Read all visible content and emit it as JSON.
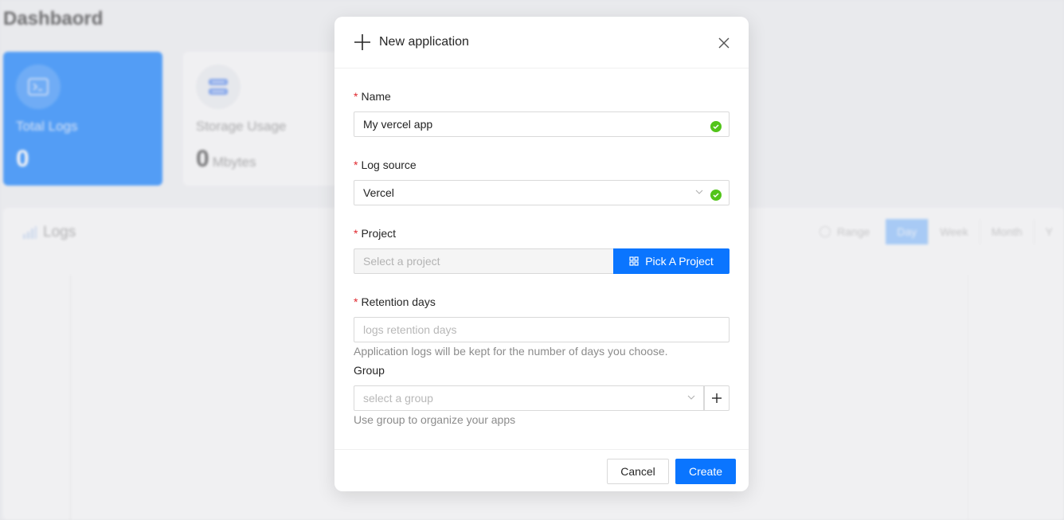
{
  "background": {
    "title": "Dashbaord",
    "cards": [
      {
        "label": "Total Logs",
        "value": "0",
        "unit": "",
        "icon": "terminal-icon"
      },
      {
        "label": "Storage Usage",
        "value": "0",
        "unit": "Mbytes",
        "icon": "storage-icon"
      }
    ],
    "logs": {
      "title": "Logs",
      "range_label": "Range",
      "segments": [
        "Day",
        "Week",
        "Month",
        "Y"
      ],
      "active_segment": "Day"
    }
  },
  "modal": {
    "title": "New application",
    "fields": {
      "name": {
        "label": "Name",
        "value": "My vercel app",
        "required": true,
        "valid": true
      },
      "log_source": {
        "label": "Log source",
        "value": "Vercel",
        "required": true,
        "valid": true
      },
      "project": {
        "label": "Project",
        "placeholder": "Select a project",
        "button_label": "Pick A Project",
        "required": true
      },
      "retention": {
        "label": "Retention days",
        "placeholder": "logs retention days",
        "help": "Application logs will be kept for the number of days you choose.",
        "required": true
      },
      "group": {
        "label": "Group",
        "placeholder": "select a group",
        "help": "Use group to organize your apps",
        "required": false
      }
    },
    "footer": {
      "cancel_label": "Cancel",
      "create_label": "Create"
    }
  },
  "colors": {
    "primary": "#0a75ff",
    "success": "#52c41a",
    "required": "#e0282e"
  }
}
